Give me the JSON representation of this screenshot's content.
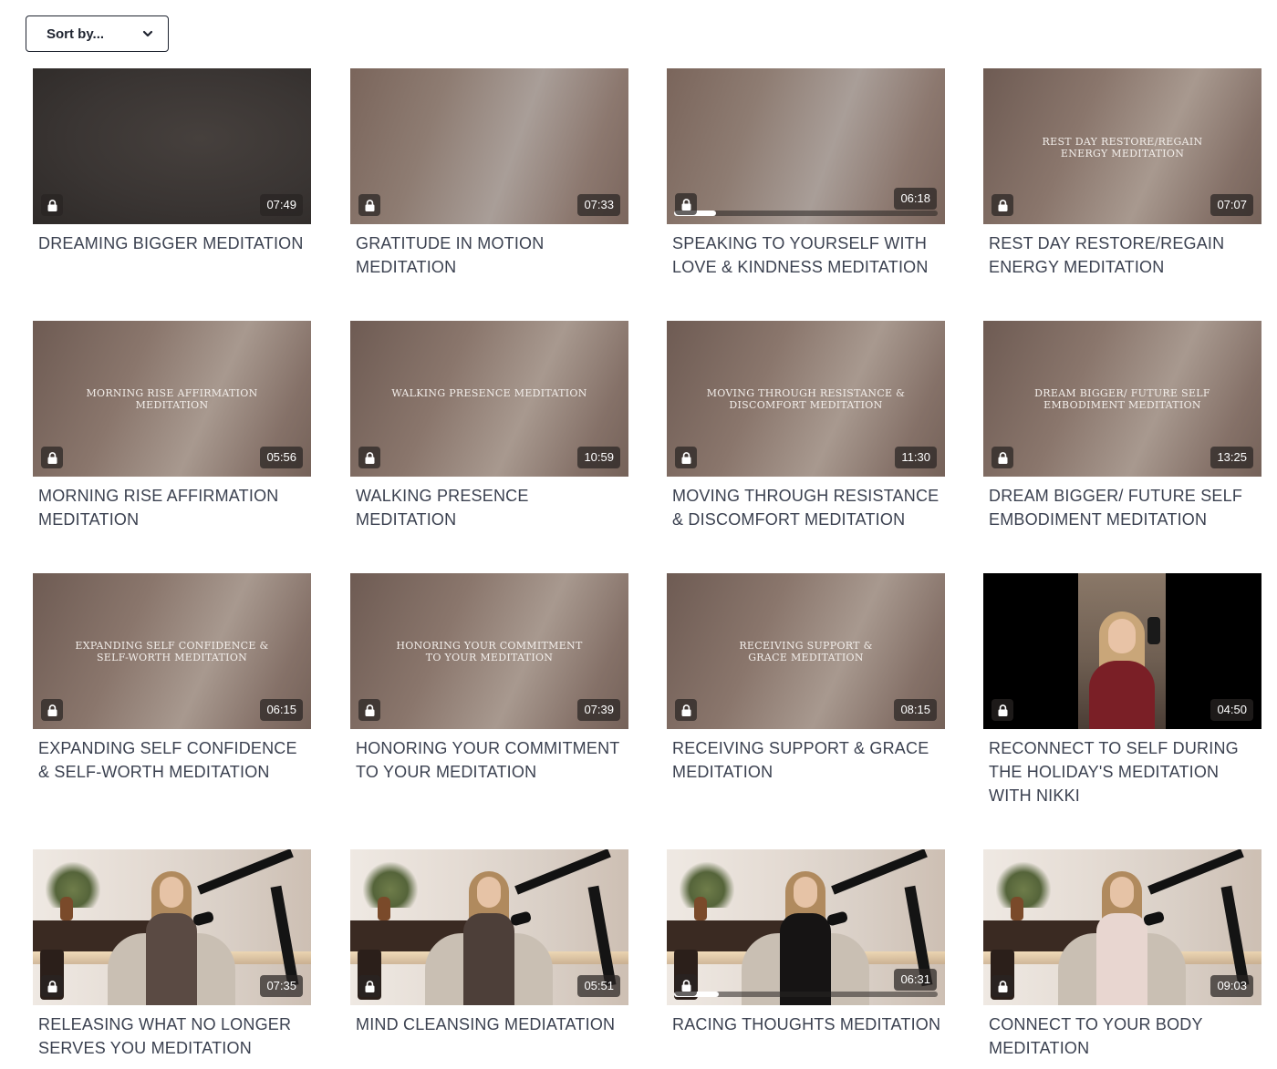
{
  "sort": {
    "label": "Sort by..."
  },
  "videos": [
    {
      "title": "DREAMING BIGGER MEDITATION",
      "duration": "07:49",
      "overlay": "",
      "style": "dark",
      "progress": null
    },
    {
      "title": "GRATITUDE IN MOTION MEDITATION",
      "duration": "07:33",
      "overlay": "",
      "style": "soft",
      "progress": null
    },
    {
      "title": "SPEAKING TO YOURSELF WITH LOVE & KINDNESS MEDITATION",
      "duration": "06:18",
      "overlay": "",
      "style": "soft",
      "progress": 0.16
    },
    {
      "title": "REST DAY RESTORE/REGAIN ENERGY MEDITATION",
      "duration": "07:07",
      "overlay": "REST DAY RESTORE/REGAIN\nENERGY MEDITATION",
      "style": "top",
      "progress": null
    },
    {
      "title": "MORNING RISE AFFIRMATION MEDITATION",
      "duration": "05:56",
      "overlay": "MORNING RISE AFFIRMATION MEDITATION",
      "style": "plain",
      "progress": null
    },
    {
      "title": "WALKING PRESENCE MEDITATION",
      "duration": "10:59",
      "overlay": "WALKING PRESENCE MEDITATION",
      "style": "plain",
      "progress": null
    },
    {
      "title": "MOVING THROUGH RESISTANCE & DISCOMFORT MEDITATION",
      "duration": "11:30",
      "overlay": "MOVING THROUGH RESISTANCE &\nDISCOMFORT MEDITATION",
      "style": "plain",
      "progress": null
    },
    {
      "title": "DREAM BIGGER/ FUTURE SELF EMBODIMENT MEDITATION",
      "duration": "13:25",
      "overlay": "DREAM BIGGER/ FUTURE SELF\nEMBODIMENT MEDITATION",
      "style": "plain",
      "progress": null
    },
    {
      "title": "EXPANDING SELF CONFIDENCE & SELF-WORTH MEDITATION",
      "duration": "06:15",
      "overlay": "EXPANDING SELF CONFIDENCE &\nSELF-WORTH MEDITATION",
      "style": "plain",
      "progress": null
    },
    {
      "title": "HONORING YOUR COMMITMENT TO YOUR MEDITATION",
      "duration": "07:39",
      "overlay": "HONORING YOUR COMMITMENT\nTO YOUR MEDITATION",
      "style": "plain",
      "progress": null
    },
    {
      "title": "RECEIVING SUPPORT & GRACE MEDITATION",
      "duration": "08:15",
      "overlay": "RECEIVING SUPPORT &\nGRACE MEDITATION",
      "style": "plain",
      "progress": null
    },
    {
      "title": "RECONNECT TO SELF DURING THE HOLIDAY'S MEDITATION WITH NIKKI",
      "duration": "04:50",
      "overlay": "",
      "style": "portrait",
      "progress": null
    },
    {
      "title": "RELEASING WHAT NO LONGER SERVES YOU MEDITATION",
      "duration": "07:35",
      "overlay": "",
      "style": "studio",
      "outfit": "#5a4a43",
      "progress": null
    },
    {
      "title": "MIND CLEANSING MEDIATATION",
      "duration": "05:51",
      "overlay": "",
      "style": "studio",
      "outfit": "#4d3f39",
      "progress": null
    },
    {
      "title": "RACING THOUGHTS MEDITATION",
      "duration": "06:31",
      "overlay": "",
      "style": "studio",
      "outfit": "#161414",
      "progress": 0.17
    },
    {
      "title": "CONNECT TO YOUR BODY MEDITATION",
      "duration": "09:03",
      "overlay": "",
      "style": "studio",
      "outfit": "#e8d6d0",
      "progress": null
    }
  ],
  "icons": {
    "lock": "lock-icon",
    "chevron": "chevron-down-icon"
  },
  "colors": {
    "text": "#3b4150",
    "badge_bg": "#2824220b8"
  }
}
